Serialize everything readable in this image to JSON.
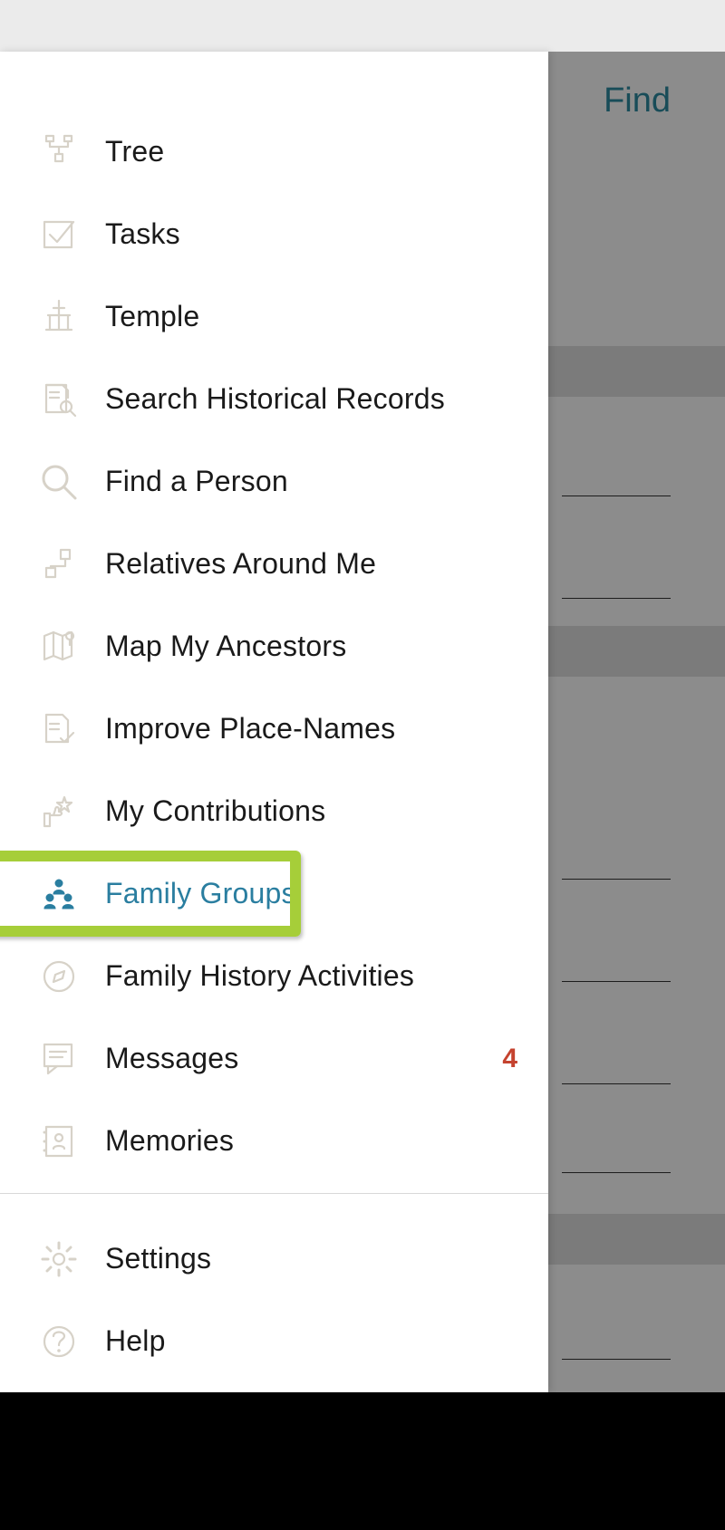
{
  "background": {
    "find_label": "Find"
  },
  "menu": {
    "items": [
      {
        "key": "tree",
        "label": "Tree",
        "icon": "tree-icon",
        "active": false,
        "badge": null
      },
      {
        "key": "tasks",
        "label": "Tasks",
        "icon": "checkbox-icon",
        "active": false,
        "badge": null
      },
      {
        "key": "temple",
        "label": "Temple",
        "icon": "temple-icon",
        "active": false,
        "badge": null
      },
      {
        "key": "search-records",
        "label": "Search Historical Records",
        "icon": "doc-search-icon",
        "active": false,
        "badge": null
      },
      {
        "key": "find-person",
        "label": "Find a Person",
        "icon": "search-icon",
        "active": false,
        "badge": null
      },
      {
        "key": "relatives",
        "label": "Relatives Around Me",
        "icon": "relatives-icon",
        "active": false,
        "badge": null
      },
      {
        "key": "map-ancestors",
        "label": "Map My Ancestors",
        "icon": "map-pin-icon",
        "active": false,
        "badge": null
      },
      {
        "key": "improve-places",
        "label": "Improve Place-Names",
        "icon": "doc-check-icon",
        "active": false,
        "badge": null
      },
      {
        "key": "contributions",
        "label": "My Contributions",
        "icon": "thumbs-star-icon",
        "active": false,
        "badge": null
      },
      {
        "key": "family-groups",
        "label": "Family Groups",
        "icon": "group-icon",
        "active": true,
        "badge": null
      },
      {
        "key": "activities",
        "label": "Family History Activities",
        "icon": "compass-icon",
        "active": false,
        "badge": null
      },
      {
        "key": "messages",
        "label": "Messages",
        "icon": "chat-icon",
        "active": false,
        "badge": "4"
      },
      {
        "key": "memories",
        "label": "Memories",
        "icon": "album-icon",
        "active": false,
        "badge": null
      }
    ],
    "footer_items": [
      {
        "key": "settings",
        "label": "Settings",
        "icon": "gear-icon"
      },
      {
        "key": "help",
        "label": "Help",
        "icon": "help-icon"
      }
    ]
  },
  "highlight": {
    "target_key": "family-groups"
  }
}
